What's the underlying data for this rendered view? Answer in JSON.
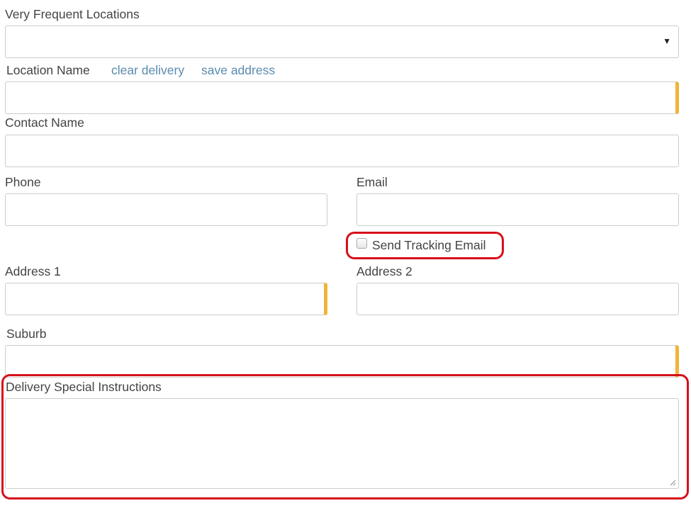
{
  "form": {
    "very_frequent_locations": {
      "label": "Very Frequent Locations",
      "selected": ""
    },
    "location_name": {
      "label": "Location Name",
      "value": ""
    },
    "links": {
      "clear_delivery": "clear delivery",
      "save_address": "save address"
    },
    "contact_name": {
      "label": "Contact Name",
      "value": ""
    },
    "phone": {
      "label": "Phone",
      "value": ""
    },
    "email": {
      "label": "Email",
      "value": ""
    },
    "send_tracking_email": {
      "label": "Send Tracking Email",
      "checked": false
    },
    "address1": {
      "label": "Address 1",
      "value": ""
    },
    "address2": {
      "label": "Address 2",
      "value": ""
    },
    "suburb": {
      "label": "Suburb",
      "value": ""
    },
    "delivery_special_instructions": {
      "label": "Delivery Special Instructions",
      "value": ""
    }
  },
  "colors": {
    "required_marker": "#f0b43a",
    "highlight": "#d6101a",
    "link": "#5a8bb0"
  },
  "icons": {
    "select_caret": "caret-down-icon",
    "textarea_resize": "resize-grip-icon"
  }
}
